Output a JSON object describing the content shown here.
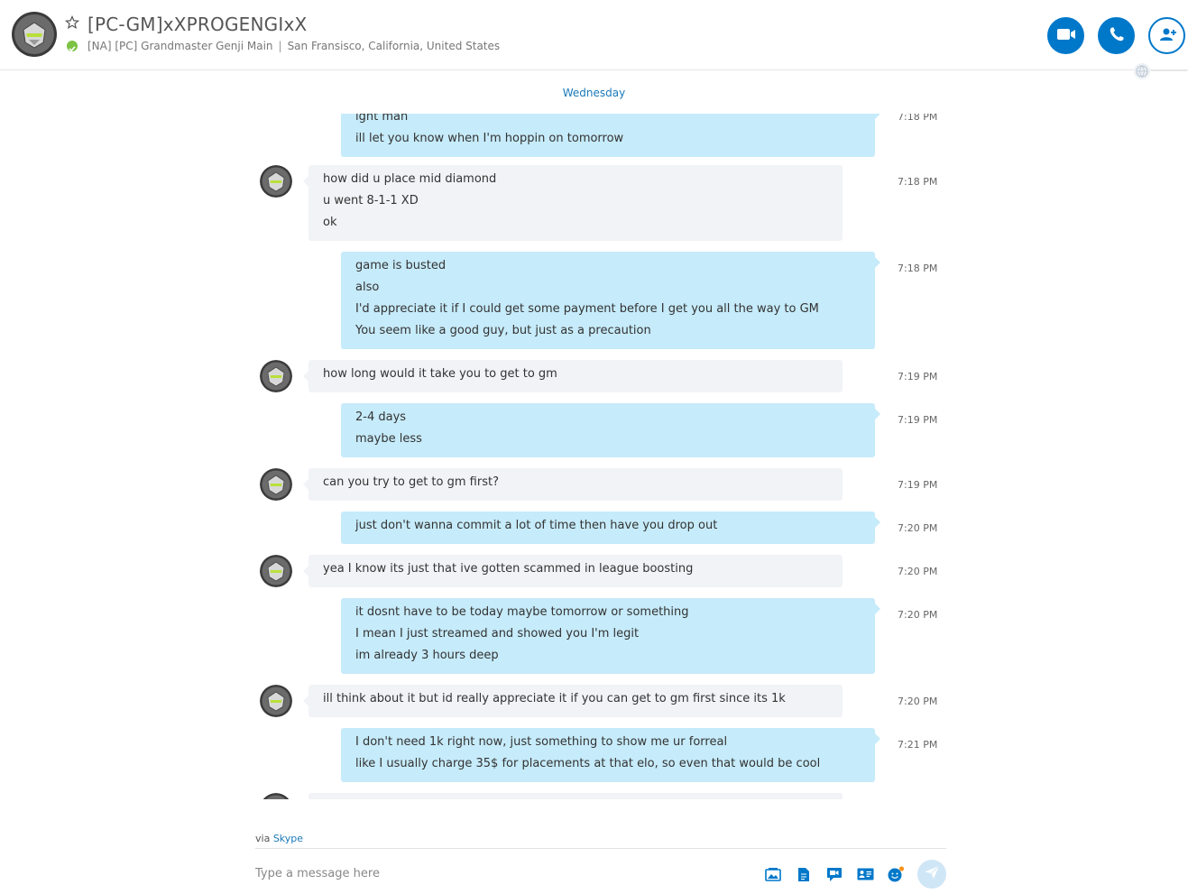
{
  "header": {
    "title": "[PC-GM]xXPROGENGIxX",
    "subtitle_mood": "[NA] [PC] Grandmaster Genji Main",
    "subtitle_separator": "|",
    "subtitle_location": "San Fransisco, California, United States",
    "status": "online",
    "status_color": "#7cc243",
    "accent_color": "#0078ca",
    "buttons": [
      {
        "name": "video-call-button",
        "icon": "video-camera-icon"
      },
      {
        "name": "audio-call-button",
        "icon": "phone-icon"
      },
      {
        "name": "add-people-button",
        "icon": "add-person-icon"
      }
    ]
  },
  "conversation": {
    "day_label": "Wednesday",
    "messages": [
      {
        "dir": "out",
        "time": "7:18 PM",
        "lines": [
          "ight man",
          "ill let you know when I'm hoppin on tomorrow"
        ]
      },
      {
        "dir": "in",
        "time": "7:18 PM",
        "lines": [
          "how did u place mid diamond",
          "u went 8-1-1 XD",
          "ok"
        ]
      },
      {
        "dir": "out",
        "time": "7:18 PM",
        "lines": [
          "game is busted",
          "also",
          "I'd appreciate it if I could get some payment before I get you all the way to GM",
          "You seem like a good guy, but just as a precaution"
        ]
      },
      {
        "dir": "in",
        "time": "7:19 PM",
        "lines": [
          "how long would it take you to get to gm"
        ]
      },
      {
        "dir": "out",
        "time": "7:19 PM",
        "lines": [
          "2-4 days",
          "maybe less"
        ]
      },
      {
        "dir": "in",
        "time": "7:19 PM",
        "lines": [
          "can you try to get to gm first?"
        ]
      },
      {
        "dir": "out",
        "time": "7:20 PM",
        "lines": [
          "just don't wanna commit a lot of time then have you drop out"
        ]
      },
      {
        "dir": "in",
        "time": "7:20 PM",
        "lines": [
          "yea I know its just that ive gotten scammed in league boosting"
        ]
      },
      {
        "dir": "out",
        "time": "7:20 PM",
        "lines": [
          "it dosnt have to be today maybe tomorrow or something",
          "I mean I just streamed and showed you I'm legit",
          "im already 3 hours deep"
        ]
      },
      {
        "dir": "in",
        "time": "7:20 PM",
        "lines": [
          "ill think about it but id really appreciate it if you can get to gm first since its 1k"
        ]
      },
      {
        "dir": "out",
        "time": "7:21 PM",
        "lines": [
          "I don't need 1k right now, just something to show me ur forreal",
          "like I usually charge 35$ for placements at that elo, so even that would be cool"
        ]
      }
    ]
  },
  "composer": {
    "via_prefix": "via",
    "via_link": "Skype",
    "placeholder": "Type a message here",
    "tools": [
      "media-gallery-icon",
      "file-icon",
      "video-message-icon",
      "contact-card-icon",
      "emoticon-icon"
    ],
    "send_icon": "send-icon"
  }
}
